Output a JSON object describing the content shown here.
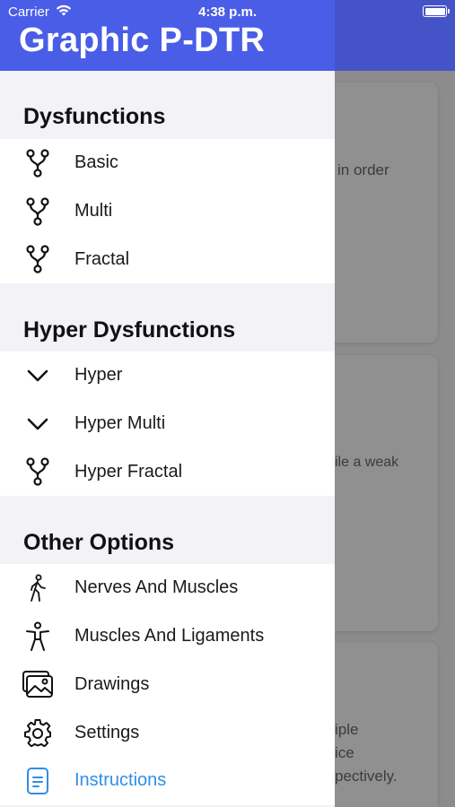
{
  "status_bar": {
    "carrier": "Carrier",
    "time": "4:38 p.m."
  },
  "header": {
    "title": "Graphic P-DTR"
  },
  "sections": [
    {
      "title": "Dysfunctions",
      "items": [
        {
          "label": "Basic",
          "icon": "fork-icon"
        },
        {
          "label": "Multi",
          "icon": "fork-icon"
        },
        {
          "label": "Fractal",
          "icon": "fork-icon"
        }
      ]
    },
    {
      "title": "Hyper Dysfunctions",
      "items": [
        {
          "label": "Hyper",
          "icon": "chevron-down-icon"
        },
        {
          "label": "Hyper Multi",
          "icon": "chevron-down-icon"
        },
        {
          "label": "Hyper Fractal",
          "icon": "fork-icon"
        }
      ]
    },
    {
      "title": "Other Options",
      "items": [
        {
          "label": "Nerves And Muscles",
          "icon": "walking-person-icon"
        },
        {
          "label": "Muscles And Ligaments",
          "icon": "accessibility-person-icon"
        },
        {
          "label": "Drawings",
          "icon": "photos-icon"
        },
        {
          "label": "Settings",
          "icon": "gear-icon"
        },
        {
          "label": "Instructions",
          "icon": "document-icon",
          "active": true
        }
      ]
    }
  ],
  "background_cards": [
    {
      "lines": [
        "in order"
      ]
    },
    {
      "lines": [
        "ile a weak"
      ]
    },
    {
      "lines": [
        "iple",
        "ice",
        "pectively."
      ]
    }
  ],
  "colors": {
    "header": "#4a5de6",
    "active": "#2f8ee8",
    "drawer_bg": "#f2f2f7"
  }
}
